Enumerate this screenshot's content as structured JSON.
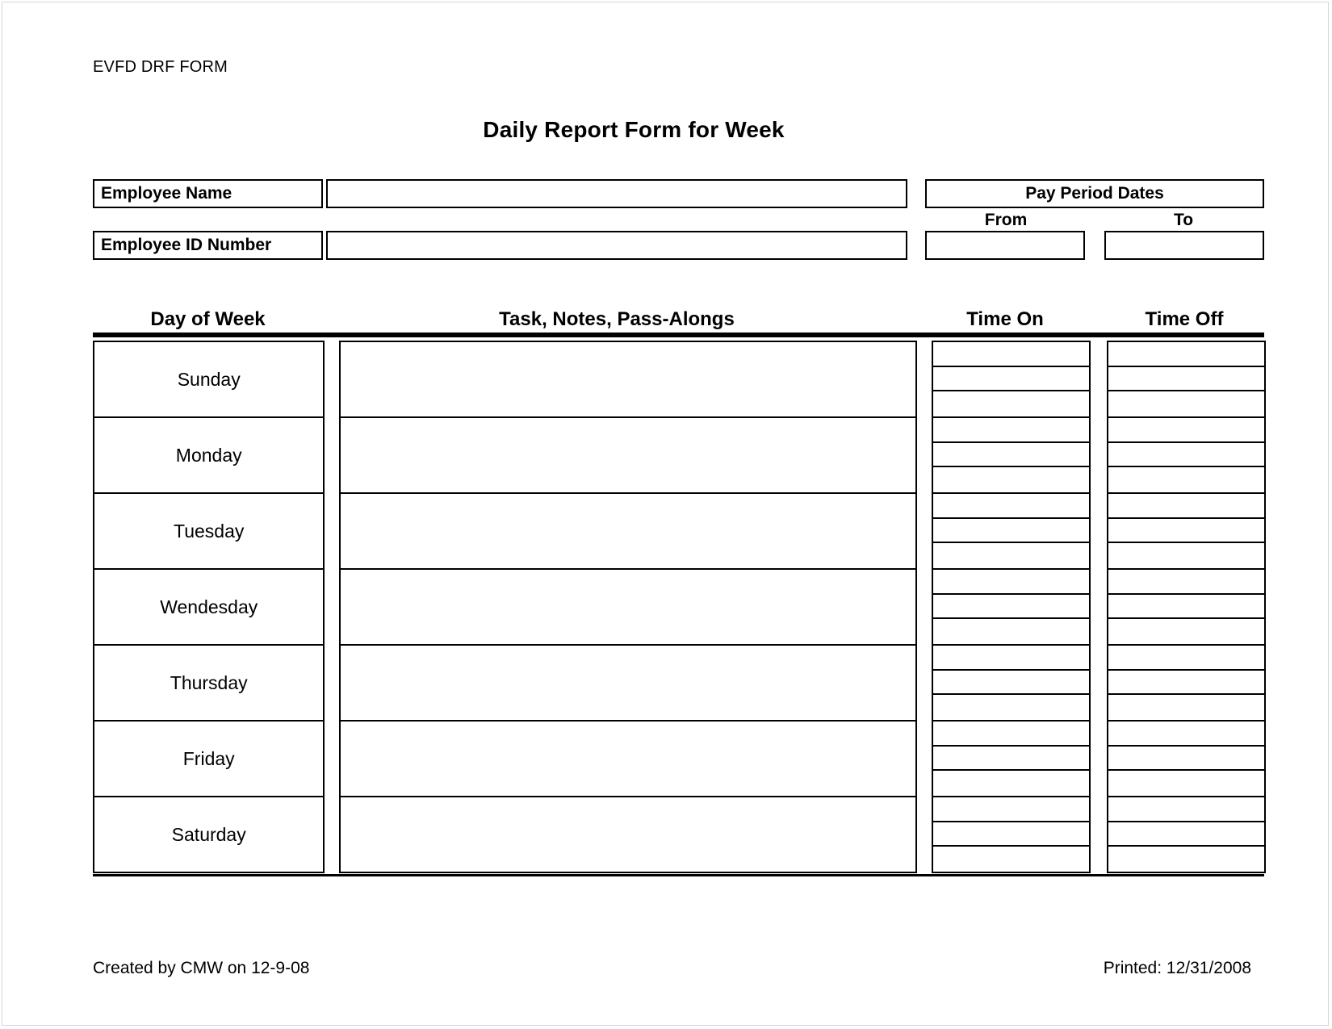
{
  "document": {
    "form_code": "EVFD DRF FORM",
    "title": "Daily Report Form for Week"
  },
  "employee_info": {
    "name_label": "Employee Name",
    "name_value": "",
    "id_label": "Employee ID Number",
    "id_value": "",
    "pay_period_label": "Pay Period Dates",
    "from_label": "From",
    "from_value": "",
    "to_label": "To",
    "to_value": ""
  },
  "table": {
    "columns": [
      "Day of Week",
      "Task, Notes, Pass-Alongs",
      "Time On",
      "Time Off"
    ],
    "rows": [
      {
        "day": "Sunday",
        "notes": "",
        "time_on": [
          "",
          "",
          ""
        ],
        "time_off": [
          "",
          "",
          ""
        ]
      },
      {
        "day": "Monday",
        "notes": "",
        "time_on": [
          "",
          "",
          ""
        ],
        "time_off": [
          "",
          "",
          ""
        ]
      },
      {
        "day": "Tuesday",
        "notes": "",
        "time_on": [
          "",
          "",
          ""
        ],
        "time_off": [
          "",
          "",
          ""
        ]
      },
      {
        "day": "Wendesday",
        "notes": "",
        "time_on": [
          "",
          "",
          ""
        ],
        "time_off": [
          "",
          "",
          ""
        ]
      },
      {
        "day": "Thursday",
        "notes": "",
        "time_on": [
          "",
          "",
          ""
        ],
        "time_off": [
          "",
          "",
          ""
        ]
      },
      {
        "day": "Friday",
        "notes": "",
        "time_on": [
          "",
          "",
          ""
        ],
        "time_off": [
          "",
          "",
          ""
        ]
      },
      {
        "day": "Saturday",
        "notes": "",
        "time_on": [
          "",
          "",
          ""
        ],
        "time_off": [
          "",
          "",
          ""
        ]
      }
    ]
  },
  "footer": {
    "created_by": "Created by CMW on 12-9-08",
    "printed": "Printed: 12/31/2008"
  }
}
